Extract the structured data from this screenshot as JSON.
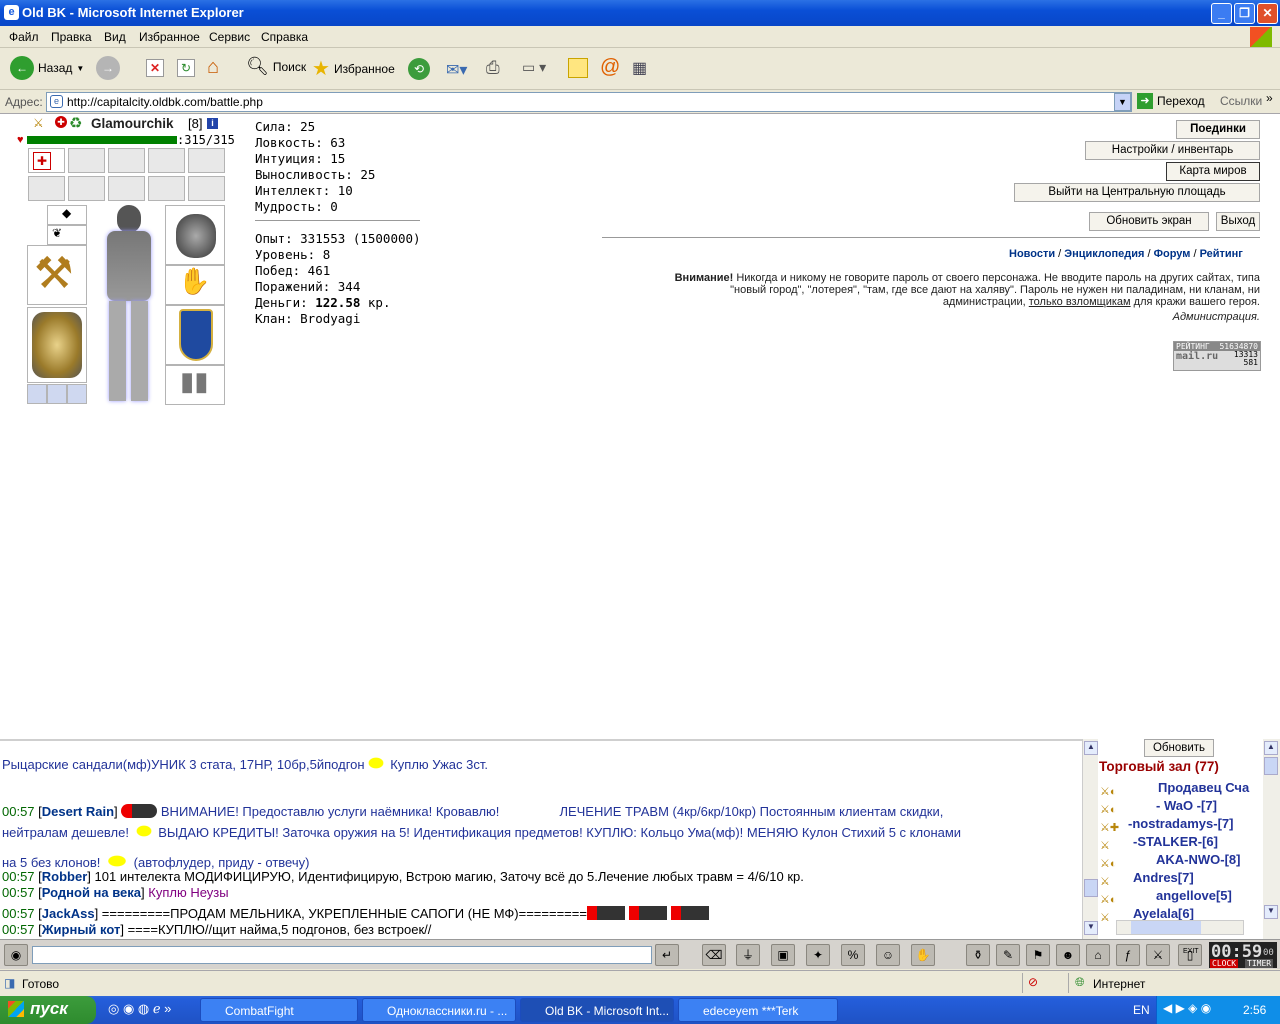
{
  "window": {
    "title": "Old BK - Microsoft Internet Explorer"
  },
  "menu": [
    "Файл",
    "Правка",
    "Вид",
    "Избранное",
    "Сервис",
    "Справка"
  ],
  "toolbar": {
    "back": "Назад",
    "search": "Поиск",
    "favorites": "Избранное"
  },
  "address": {
    "label": "Адрес:",
    "url": "http://capitalcity.oldbk.com/battle.php",
    "go": "Переход",
    "links": "Ссылки"
  },
  "character": {
    "name": "Glamourchik",
    "level": "[8]",
    "hp": ":315/315",
    "hp_fraction": 1.0
  },
  "stats": [
    "Сила: 25",
    "Ловкость: 63",
    "Интуиция: 15",
    "Выносливость: 25",
    "Интеллект: 10",
    "Мудрость: 0"
  ],
  "info": [
    "Опыт: 331553 (1500000)",
    "Уровень: 8",
    "Побед: 461",
    "Поражений: 344"
  ],
  "money": {
    "label": "Деньги:",
    "value": "122.58",
    "unit": "кр."
  },
  "clan": "Клан: Brodyagi",
  "buttons": {
    "fights": "Поединки",
    "settings": "Настройки / инвентарь",
    "worldmap": "Карта миров",
    "exit_square": "Выйти на Центральную площадь",
    "refresh": "Обновить экран",
    "logout": "Выход"
  },
  "links": [
    "Новости",
    "Энциклопедия",
    "Форум",
    "Рейтинг"
  ],
  "warning": {
    "bold": "Внимание!",
    "line1": "Никогда и никому не говорите пароль от своего персонажа. Не вводите пароль на других сайтах, типа",
    "line2": "\"новый город\", \"лотерея\", \"там, где все дают на халяву\". Пароль не нужен ни паладинам, ни кланам, ни",
    "line3a": "администрации,",
    "line3u": "только взломщикам",
    "line3b": "для кражи вашего героя.",
    "sign": "Администрация."
  },
  "counter": {
    "label": "РЕЙТИНГ",
    "n1": "51634870",
    "n2": "13313",
    "n3": "581",
    "brand": "mail.ru"
  },
  "chat": {
    "line0": "Рыцарские сандали(мф)УНИК 3 стата, 17НР, 10бр,5йподгон",
    "line0b": "Куплю Ужас 3ст.",
    "t1": "00:57",
    "n1": "Desert Rain",
    "m1a": "ВНИМАНИЕ! Предоставлю услуги наёмника! Кровавлю!",
    "m1b": "ЛЕЧЕНИЕ ТРАВМ (4кр/6кр/10кр) Постоянным клиентам скидки,",
    "m1c": "нейтралам дешевле!",
    "m1d": "ВЫДАЮ КРЕДИТЫ! Заточка оружия на 5! Идентификация предметов! КУПЛЮ: Кольцо Ума(мф)! МЕНЯЮ Кулон Стихий 5 с клонами",
    "m1e": "на 5 без клонов!",
    "m1f": "(автофлудер, приду - отвечу)",
    "t2": "00:57",
    "n2": "Robber",
    "m2": "101 интелекта МОДИФИЦИРУЮ, Идентифицирую, Встрою магию, Заточу всё до 5.Лечение любых травм = 4/6/10 кр.",
    "t3": "00:57",
    "n3": "Родной на века",
    "m3": "Куплю Неузы",
    "t4": "00:57",
    "n4": "JackAss",
    "m4": "=========ПРОДАМ МЕЛЬНИКА, УКРЕПЛЕННЫЕ САПОГИ (НЕ МФ)=========",
    "t5": "00:57",
    "n5": "Жирный кот",
    "m5": "====КУПЛЮ//щит найма,5 подгонов, без встроек//"
  },
  "online": {
    "refresh": "Обновить",
    "room": "Торговый зал (77)",
    "users": [
      "Продавец Сча",
      "- WaO -[7]",
      "-nostradamys-[7]",
      "-STALKER-[6]",
      "AKA-NWO-[8]",
      "Andres[7]",
      "angellove[5]",
      "Ayelala[6]"
    ]
  },
  "clock": {
    "time": "00:59",
    "sec": "00",
    "clock_label": "CLOCK",
    "timer_label": "TIMER",
    "exit": "EXIT"
  },
  "status": {
    "ready": "Готово",
    "zone": "Интернет"
  },
  "taskbar": {
    "start": "пуск",
    "tasks": [
      "CombatFight",
      "Одноклассники.ru - ...",
      "Old BK - Microsoft Int...",
      "edeceyem ***Terk"
    ],
    "lang": "EN",
    "time": "2:56"
  }
}
